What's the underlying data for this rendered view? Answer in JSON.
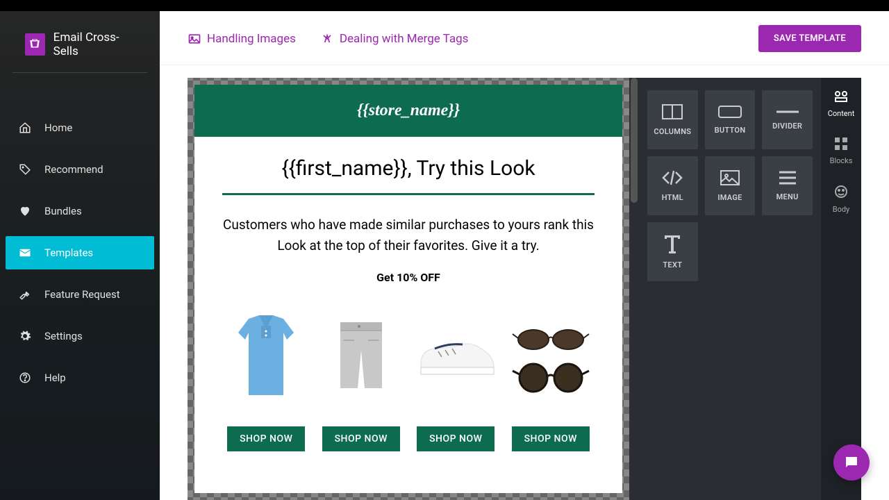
{
  "brand": {
    "title": "Email Cross-Sells"
  },
  "nav": [
    {
      "label": "Home",
      "icon": "home"
    },
    {
      "label": "Recommend",
      "icon": "tag"
    },
    {
      "label": "Bundles",
      "icon": "heart"
    },
    {
      "label": "Templates",
      "icon": "mail",
      "active": true
    },
    {
      "label": "Feature Request",
      "icon": "wrench"
    },
    {
      "label": "Settings",
      "icon": "gear"
    },
    {
      "label": "Help",
      "icon": "help"
    }
  ],
  "toolbar": {
    "link1": "Handling Images",
    "link2": "Dealing with Merge Tags",
    "save": "SAVE TEMPLATE"
  },
  "email": {
    "store": "{{store_name}}",
    "headline": "{{first_name}}, Try this Look",
    "para": "Customers who have made similar purchases to yours rank this Look at the top of their favorites. Give it a try.",
    "offer": "Get 10% OFF",
    "products": [
      "polo-shirt",
      "shorts",
      "sneaker",
      "sunglasses"
    ],
    "cta": "SHOP NOW"
  },
  "tools": [
    {
      "label": "COLUMNS",
      "icon": "columns"
    },
    {
      "label": "BUTTON",
      "icon": "button"
    },
    {
      "label": "DIVIDER",
      "icon": "divider"
    },
    {
      "label": "HTML",
      "icon": "html"
    },
    {
      "label": "IMAGE",
      "icon": "image"
    },
    {
      "label": "MENU",
      "icon": "menu"
    },
    {
      "label": "TEXT",
      "icon": "text"
    }
  ],
  "tabs": [
    {
      "label": "Content",
      "icon": "content",
      "active": true
    },
    {
      "label": "Blocks",
      "icon": "blocks"
    },
    {
      "label": "Body",
      "icon": "body"
    }
  ]
}
